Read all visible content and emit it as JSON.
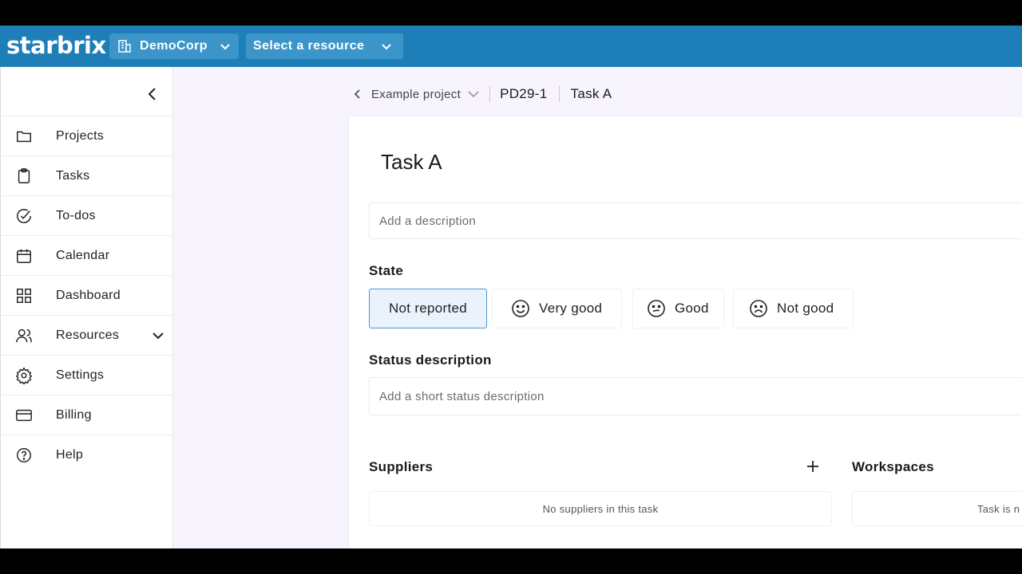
{
  "topbar": {
    "logo": "starbrix",
    "organization": "DemoCorp",
    "resource_select": "Select a resource",
    "color": "#1e7fb8"
  },
  "sidebar": {
    "items": [
      {
        "label": "Projects",
        "icon": "folder-icon"
      },
      {
        "label": "Tasks",
        "icon": "clipboard-icon"
      },
      {
        "label": "To-dos",
        "icon": "check-circle-icon"
      },
      {
        "label": "Calendar",
        "icon": "calendar-icon"
      },
      {
        "label": "Dashboard",
        "icon": "grid-icon"
      },
      {
        "label": "Resources",
        "icon": "users-icon",
        "expandable": true
      },
      {
        "label": "Settings",
        "icon": "gear-icon"
      },
      {
        "label": "Billing",
        "icon": "credit-card-icon"
      },
      {
        "label": "Help",
        "icon": "help-circle-icon"
      }
    ]
  },
  "breadcrumb": {
    "project": "Example project",
    "task_id": "PD29-1",
    "task_name": "Task A"
  },
  "task": {
    "title": "Task A",
    "description_placeholder": "Add a description",
    "state_label": "State",
    "states": [
      {
        "label": "Not reported",
        "selected": true
      },
      {
        "label": "Very good",
        "icon": "smile-icon"
      },
      {
        "label": "Good",
        "icon": "neutral-face-icon"
      },
      {
        "label": "Not good",
        "icon": "frown-icon"
      }
    ],
    "status_label": "Status description",
    "status_placeholder": "Add a short status description",
    "suppliers_label": "Suppliers",
    "suppliers_empty": "No suppliers in this task",
    "workspaces_label": "Workspaces",
    "workspaces_empty": "Task is n"
  },
  "colors": {
    "selected_border": "#4a97d6",
    "selected_bg": "#eaf3fc",
    "main_bg": "#f8f4fd"
  }
}
